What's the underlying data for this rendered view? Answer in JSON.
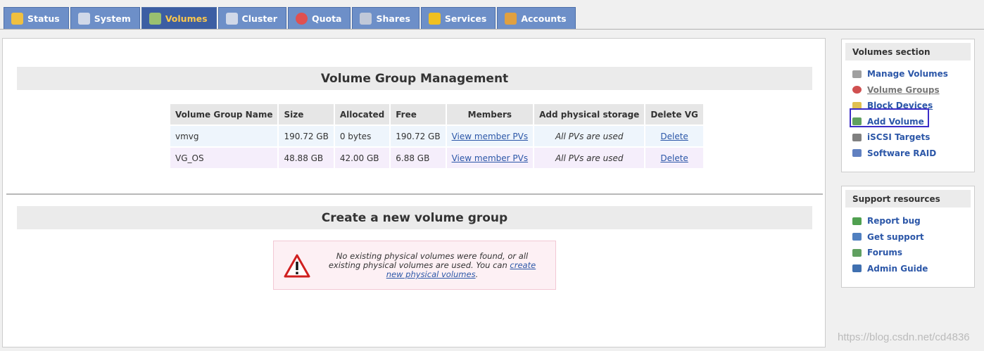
{
  "tabs": [
    {
      "label": "Status",
      "icon": "sun-icon",
      "color": "#f0c040",
      "active": false
    },
    {
      "label": "System",
      "icon": "monitor-icon",
      "color": "#d0d8e8",
      "active": false
    },
    {
      "label": "Volumes",
      "icon": "drive-icon",
      "color": "#9ac070",
      "active": true
    },
    {
      "label": "Cluster",
      "icon": "cluster-icon",
      "color": "#d0d8e8",
      "active": false
    },
    {
      "label": "Quota",
      "icon": "pie-chart-icon",
      "color": "#e05050",
      "active": false
    },
    {
      "label": "Shares",
      "icon": "shares-icon",
      "color": "#c0c8d8",
      "active": false
    },
    {
      "label": "Services",
      "icon": "lightning-icon",
      "color": "#f0c020",
      "active": false
    },
    {
      "label": "Accounts",
      "icon": "users-icon",
      "color": "#e0a040",
      "active": false
    }
  ],
  "main": {
    "vg_section_title": "Volume Group Management",
    "table": {
      "headers": [
        "Volume Group Name",
        "Size",
        "Allocated",
        "Free",
        "Members",
        "Add physical storage",
        "Delete VG"
      ],
      "rows": [
        {
          "name": "vmvg",
          "size": "190.72 GB",
          "allocated": "0 bytes",
          "free": "190.72 GB",
          "members": "View member PVs",
          "add_storage": "All PVs are used",
          "delete": "Delete"
        },
        {
          "name": "VG_OS",
          "size": "48.88 GB",
          "allocated": "42.00 GB",
          "free": "6.88 GB",
          "members": "View member PVs",
          "add_storage": "All PVs are used",
          "delete": "Delete"
        }
      ]
    },
    "create_section_title": "Create a new volume group",
    "warning": {
      "text": "No existing physical volumes were found, or all existing physical volumes are used. You can",
      "link": "create new physical volumes",
      "suffix": "."
    }
  },
  "sidebar": {
    "volumes_title": "Volumes section",
    "volumes_links": [
      {
        "label": "Manage Volumes",
        "icon": "drive-icon",
        "color": "#a0a0a0"
      },
      {
        "label": "Volume Groups",
        "icon": "volume-groups-icon",
        "color": "#d05050"
      },
      {
        "label": "Block Devices",
        "icon": "block-devices-icon",
        "color": "#e0c050"
      },
      {
        "label": "Add Volume",
        "icon": "add-volume-icon",
        "color": "#60a060"
      },
      {
        "label": "iSCSI Targets",
        "icon": "iscsi-icon",
        "color": "#808080"
      },
      {
        "label": "Software RAID",
        "icon": "raid-icon",
        "color": "#6080c0"
      }
    ],
    "support_title": "Support resources",
    "support_links": [
      {
        "label": "Report bug",
        "icon": "bug-icon",
        "color": "#50a050"
      },
      {
        "label": "Get support",
        "icon": "support-icon",
        "color": "#5080c0"
      },
      {
        "label": "Forums",
        "icon": "forums-icon",
        "color": "#60a060"
      },
      {
        "label": "Admin Guide",
        "icon": "book-icon",
        "color": "#4070b0"
      }
    ]
  },
  "watermark": "https://blog.csdn.net/cd4836"
}
